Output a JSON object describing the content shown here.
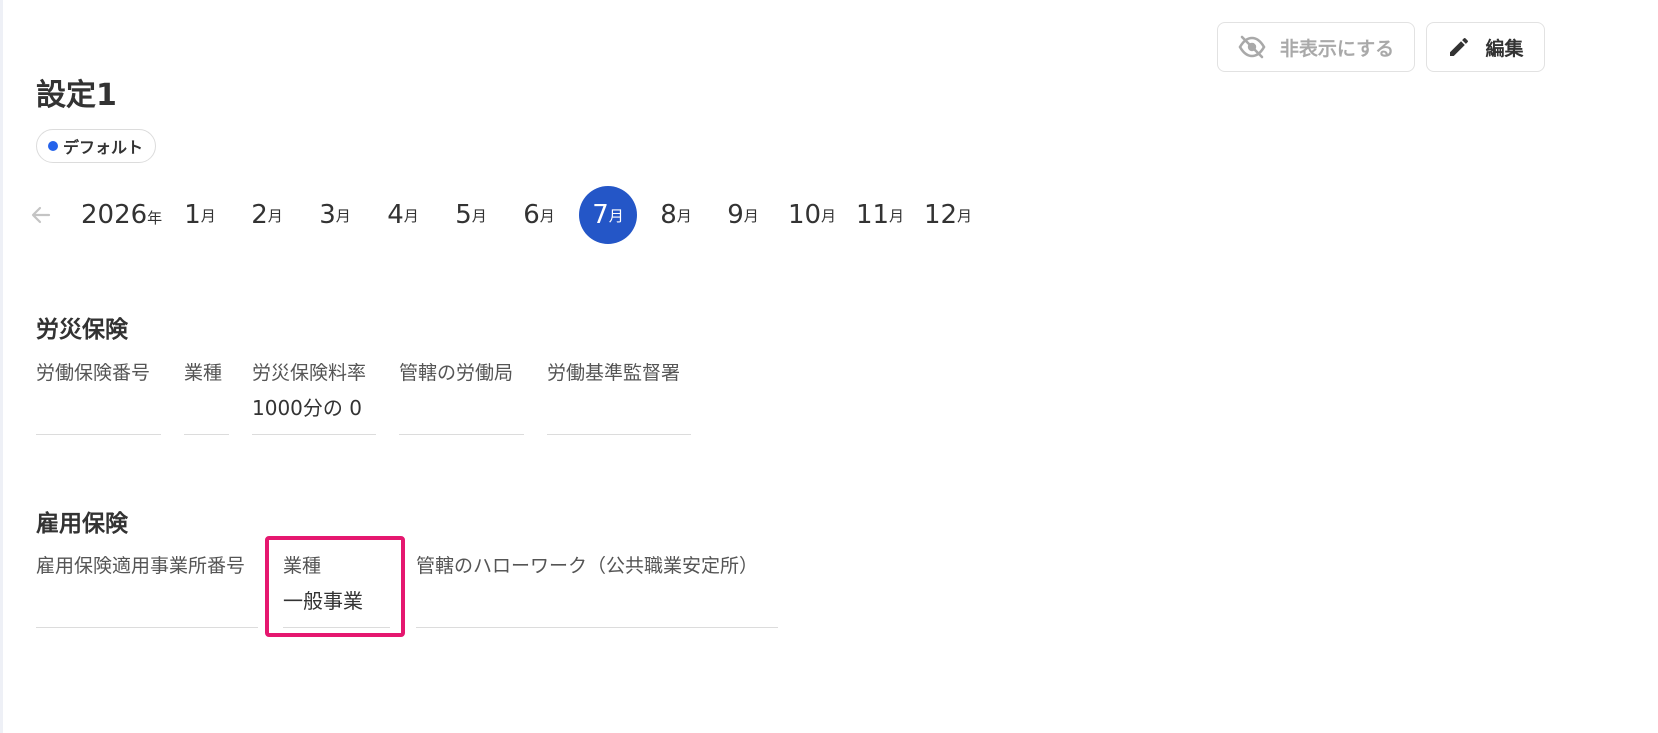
{
  "header": {
    "hide_label": "非表示にする",
    "edit_label": "編集"
  },
  "page": {
    "title": "設定1",
    "badge": "デフォルト",
    "badge_color": "#2563eb"
  },
  "calendar": {
    "year": "2026",
    "year_unit": "年",
    "month_unit": "月",
    "months": [
      "1",
      "2",
      "3",
      "4",
      "5",
      "6",
      "7",
      "8",
      "9",
      "10",
      "11",
      "12"
    ],
    "selected_month": "7",
    "accent_color": "#2456c7"
  },
  "rousai": {
    "title": "労災保険",
    "fields": [
      {
        "label": "労働保険番号",
        "value": ""
      },
      {
        "label": "業種",
        "value": ""
      },
      {
        "label": "労災保険料率",
        "value": "1000分の 0"
      },
      {
        "label": "管轄の労働局",
        "value": ""
      },
      {
        "label": "労働基準監督署",
        "value": ""
      }
    ]
  },
  "koyou": {
    "title": "雇用保険",
    "fields": [
      {
        "label": "雇用保険適用事業所番号",
        "value": ""
      },
      {
        "label": "業種",
        "value": "一般事業"
      },
      {
        "label": "管轄のハローワーク（公共職業安定所）",
        "value": ""
      }
    ]
  },
  "icons": {
    "hide": "eye-off-icon",
    "edit": "pencil-icon",
    "prev": "arrow-left-icon"
  },
  "highlight_color": "#e5176f"
}
